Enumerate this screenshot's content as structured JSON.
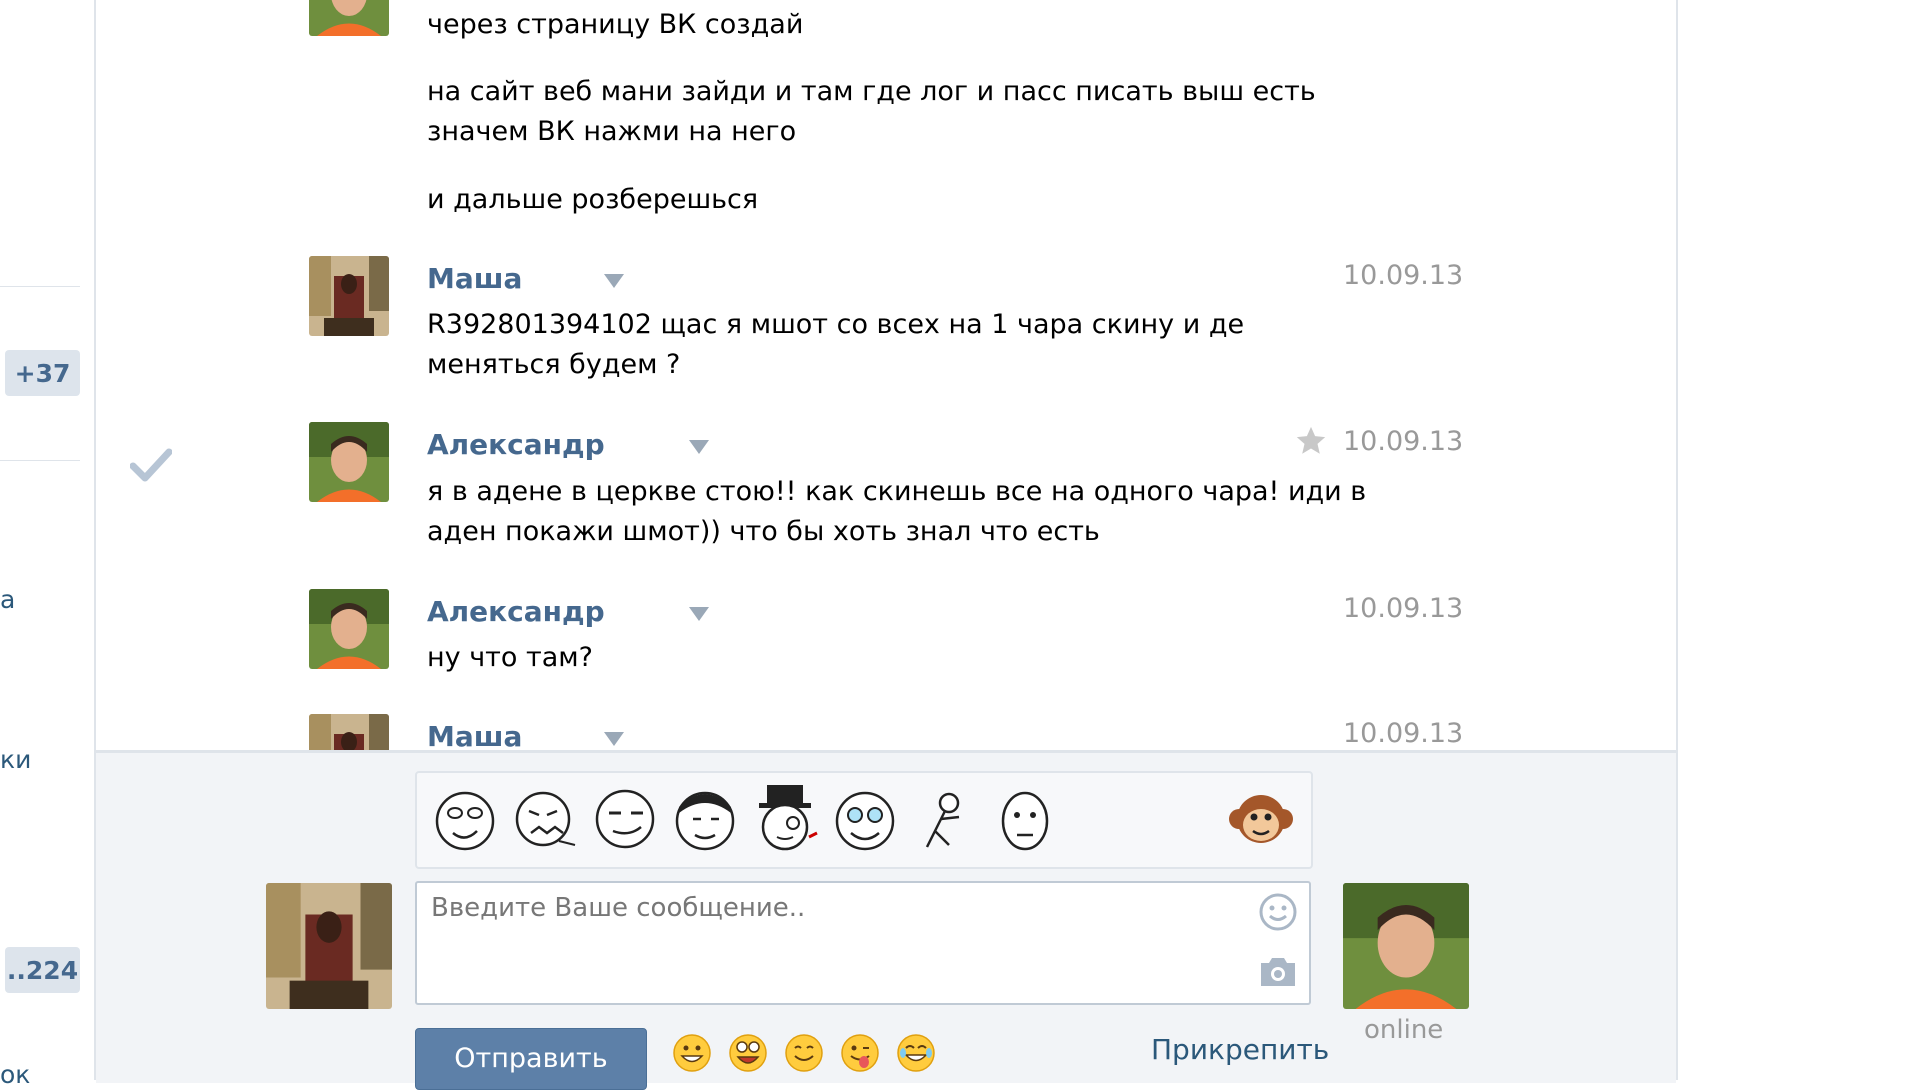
{
  "sidebar": {
    "badge_top": "+37",
    "text_a": "а",
    "text_ki": "ки",
    "badge_bottom": "..224",
    "text_ok": "ок"
  },
  "messages": [
    {
      "author": "",
      "date": "",
      "lines": [
        "через страницу ВК создай"
      ]
    },
    {
      "author": "",
      "date": "",
      "lines": [
        "на сайт веб мани зайди и там где лог и пасс писать выш есть",
        "значем ВК нажми на него"
      ]
    },
    {
      "author": "",
      "date": "",
      "lines": [
        "и дальше розберешься"
      ]
    },
    {
      "author": "Маша",
      "date": "10.09.13",
      "lines": [
        "R392801394102 щас я мшот со всех на 1 чара скину и де",
        "меняться будем ?"
      ]
    },
    {
      "author": "Александр",
      "date": "10.09.13",
      "lines": [
        "я в адене в церкве стою!! как скинешь все на одного чара! иди в",
        "аден покажи шмот)) что бы хоть знал что есть"
      ]
    },
    {
      "author": "Александр",
      "date": "10.09.13",
      "lines": [
        "ну что там?"
      ]
    },
    {
      "author": "Маша",
      "date": "10.09.13",
      "lines": []
    }
  ],
  "composer": {
    "placeholder": "Введите Ваше сообщение..",
    "send_label": "Отправить",
    "attach_label": "Прикрепить",
    "status": "online"
  },
  "colors": {
    "link": "#45688e",
    "send_button": "#5d80a8",
    "date": "#999999",
    "star": "#c8c8c8",
    "checkmark": "#b7c5d5"
  },
  "icons": {
    "read_mark": "checkmark-icon",
    "favorite": "star-icon",
    "smile": "smile-icon",
    "camera": "camera-icon",
    "monkey": "monkey-icon"
  }
}
